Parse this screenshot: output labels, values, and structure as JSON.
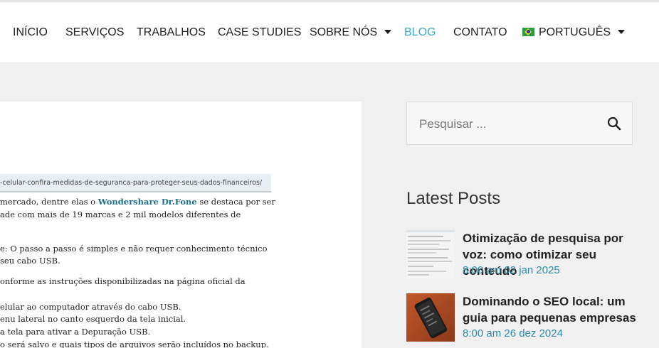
{
  "nav": {
    "items": [
      {
        "label": "INÍCIO"
      },
      {
        "label": "SERVIÇOS"
      },
      {
        "label": "TRABALHOS"
      },
      {
        "label": "CASE STUDIES"
      },
      {
        "label": "SOBRE NÓS"
      },
      {
        "label": "BLOG"
      },
      {
        "label": "CONTATO"
      },
      {
        "label": "PORTUGUÊS"
      }
    ],
    "active": "BLOG",
    "accent_color": "#3aa6c2",
    "language_flag": "brazil-flag-icon"
  },
  "article": {
    "url_text": "-celular-confira-medidas-de-seguranca-para-proteger-seus-dados-financeiros/",
    "lines": [
      {
        "pre": "mercado, dentre elas o ",
        "link": "Wondershare Dr.Fone",
        "post": " se destaca por ser"
      },
      {
        "text": "ade com mais de 19 marcas e 2 mil modelos diferentes de"
      },
      {
        "text": "e: O passo a passo é simples e não requer conhecimento técnico"
      },
      {
        "text": "seu cabo USB."
      },
      {
        "text": "onforme as instruções disponibilizadas na página oficial da"
      },
      {
        "text": "elular ao computador através do cabo USB."
      },
      {
        "text": "enu lateral no canto esquerdo da tela inicial."
      },
      {
        "text": "a tela para ativar a Depuração USB."
      },
      {
        "text": "o será salvo e quais tipos de arquivos serão incluídos no backup."
      }
    ]
  },
  "sidebar": {
    "search": {
      "placeholder": "Pesquisar ..."
    },
    "latest_title": "Latest Posts",
    "posts": [
      {
        "title": "Otimização de pesquisa por voz: como otimizar seu conteúdo",
        "date": "8:00 am 02 jan 2025",
        "thumb": "document-screenshot-thumbnail"
      },
      {
        "title": "Dominando o SEO local: um guia para pequenas empresas",
        "date": "8:00 am 26 dez 2024",
        "thumb": "smartphone-photo-thumbnail"
      }
    ],
    "date_color": "#2e88a8"
  }
}
